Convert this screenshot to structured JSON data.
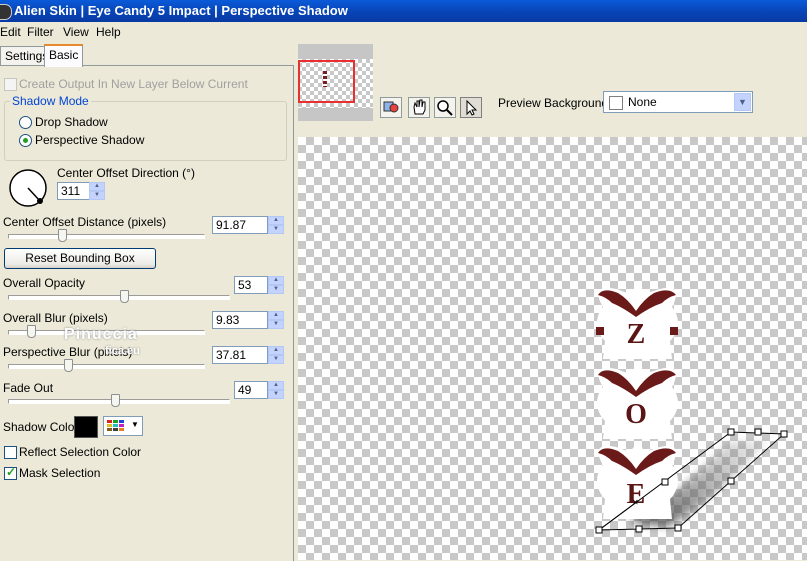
{
  "window": {
    "title": "Alien Skin  |  Eye Candy 5 Impact  |  Perspective Shadow"
  },
  "menu": [
    "Edit",
    "Filter",
    "View",
    "Help"
  ],
  "tabs": [
    {
      "label": "Settings",
      "active": false
    },
    {
      "label": "Basic",
      "active": true
    }
  ],
  "basic": {
    "create_output_label": "Create Output In New Layer Below Current",
    "create_output_checked": false,
    "create_output_enabled": false,
    "shadow_mode": {
      "title": "Shadow Mode",
      "options": [
        {
          "label": "Drop Shadow",
          "selected": false
        },
        {
          "label": "Perspective Shadow",
          "selected": true
        }
      ]
    },
    "direction": {
      "label": "Center Offset Direction (°)",
      "value": "311"
    },
    "offset_distance": {
      "label": "Center Offset Distance (pixels)",
      "value": "91.87",
      "slider": 0.27
    },
    "reset_button": "Reset Bounding Box",
    "overall_opacity": {
      "label": "Overall Opacity",
      "value": "53",
      "slider": 0.53
    },
    "overall_blur": {
      "label": "Overall Blur (pixels)",
      "value": "9.83",
      "slider": 0.1
    },
    "perspective_blur": {
      "label": "Perspective Blur (pixels)",
      "value": "37.81",
      "slider": 0.3
    },
    "fade_out": {
      "label": "Fade Out",
      "value": "49",
      "slider": 0.49
    },
    "shadow_color": {
      "label": "Shadow Color",
      "swatch": "#000000"
    },
    "reflect_selection": {
      "label": "Reflect Selection Color",
      "checked": false
    },
    "mask_selection": {
      "label": "Mask Selection",
      "checked": true
    }
  },
  "watermark": {
    "name": "Pinuccia",
    "suffix": "fica.eu"
  },
  "preview": {
    "background_label": "Preview Background:",
    "background_value": "None",
    "tools": [
      "preview-icon",
      "hand-icon",
      "zoom-icon",
      "arrow-icon"
    ],
    "letters": [
      "Z",
      "O",
      "E"
    ],
    "accent": "#6b1a1a",
    "thumbnail_border": "#e83030"
  }
}
